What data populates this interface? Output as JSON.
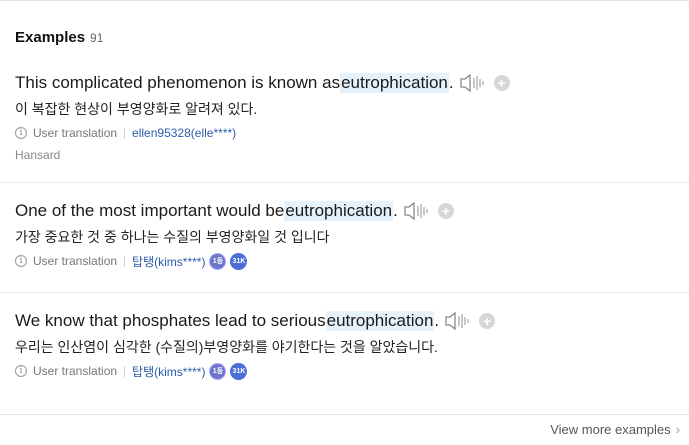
{
  "header": {
    "title": "Examples",
    "count": "91"
  },
  "examples": [
    {
      "en_before": "This complicated phenomenon is known as ",
      "en_highlight": "eutrophication",
      "en_after": ".",
      "ko": "이 복잡한 현상이 부영양화로 알려져 있다.",
      "translation_type": "User translation",
      "user": "ellen95328(elle****)",
      "source": "Hansard"
    },
    {
      "en_before": "One of the most important would be ",
      "en_highlight": "eutrophication",
      "en_after": ".",
      "ko": "가장 중요한 것 중 하나는 수질의 부영양화일 것 입니다",
      "translation_type": "User translation",
      "user": "탑탱(kims****)",
      "badge_level": "1등",
      "badge_points": "31K"
    },
    {
      "en_before": "We know that phosphates lead to serious ",
      "en_highlight": "eutrophication",
      "en_after": ".",
      "ko": "우리는 인산염이 심각한 (수질의)부영양화를 야기한다는 것을 알았습니다.",
      "translation_type": "User translation",
      "user": "탑탱(kims****)",
      "badge_level": "1등",
      "badge_points": "31K"
    }
  ],
  "footer": {
    "more_label": "View more examples"
  },
  "icons": {
    "speaker": "speaker-icon",
    "add": "add-icon",
    "info": "info-icon",
    "chevron": "chevron-right-icon"
  },
  "colors": {
    "highlight_bg": "#e6f2fb",
    "link": "#2a5ba8",
    "badge_level": "#6b76c9",
    "badge_points": "#4a6dd8"
  }
}
